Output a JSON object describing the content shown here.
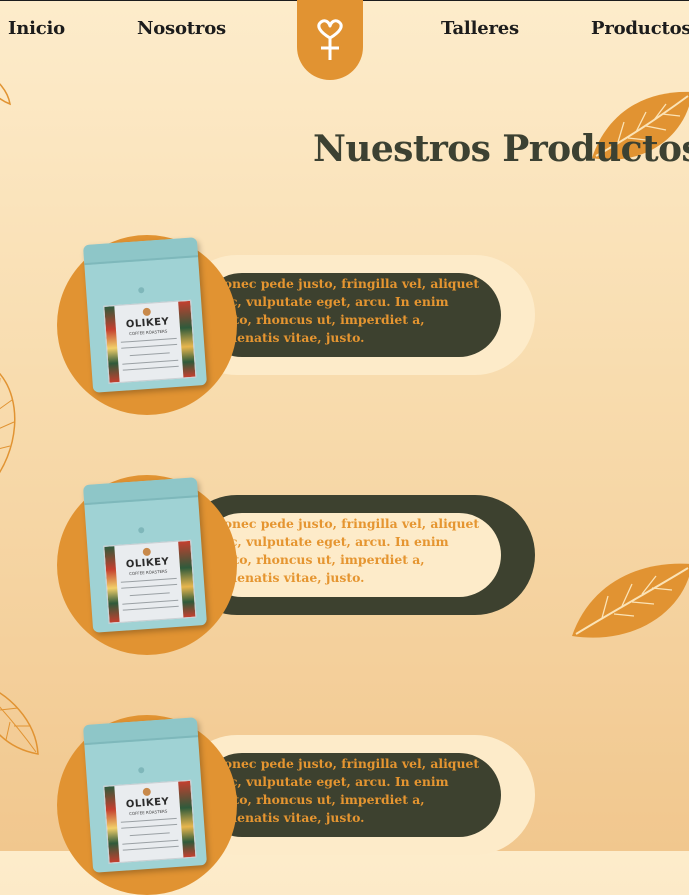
{
  "nav": {
    "left": [
      {
        "label": "Inicio"
      },
      {
        "label": "Nosotros"
      }
    ],
    "right": [
      {
        "label": "Talleres"
      },
      {
        "label": "Productos"
      }
    ],
    "logo_icon": "heart-cross-logo-icon"
  },
  "page": {
    "title": "Nuestros Productos"
  },
  "products": [
    {
      "description": "Donec pede justo, fringilla vel, aliquet nec, vulputate eget, arcu. In enim justo, rhoncus ut, imperdiet a, venenatis vitae, justo.",
      "style": "dark-inner",
      "image": {
        "brand": "OLIKEY",
        "sub": "COFFEE ROASTERS"
      }
    },
    {
      "description": "Donec pede justo, fringilla vel, aliquet nec, vulputate eget, arcu. In enim justo, rhoncus ut, imperdiet a, venenatis vitae, justo.",
      "style": "light-inner",
      "image": {
        "brand": "OLIKEY",
        "sub": "COFFEE ROASTERS"
      }
    },
    {
      "description": "Donec pede justo, fringilla vel, aliquet nec, vulputate eget, arcu. In enim justo, rhoncus ut, imperdiet a, venenatis vitae, justo.",
      "style": "dark-inner",
      "image": {
        "brand": "OLIKEY",
        "sub": "COFFEE ROASTERS"
      }
    }
  ],
  "colors": {
    "accent_orange": "#e19332",
    "dark_olive": "#3d412f",
    "cream": "#fdebc9",
    "title": "#3c4132",
    "text_orange": "#e59530"
  }
}
